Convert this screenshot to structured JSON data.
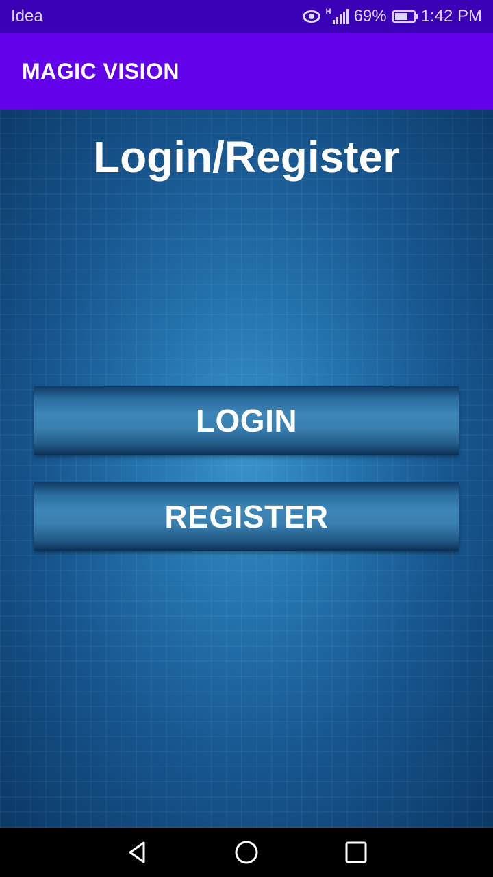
{
  "status_bar": {
    "carrier": "Idea",
    "network_type": "H",
    "battery_percent": "69%",
    "battery_level": 0.69,
    "time": "1:42 PM",
    "icons": [
      "eye-icon",
      "signal-icon",
      "battery-icon"
    ]
  },
  "app_bar": {
    "title": "MAGIC VISION"
  },
  "main": {
    "title": "Login/Register",
    "login_label": "LOGIN",
    "register_label": "REGISTER"
  },
  "nav_bar": {
    "icons": [
      "back-icon",
      "home-icon",
      "recents-icon"
    ]
  },
  "colors": {
    "status_bar": "#3a00b6",
    "app_bar": "#6200ea",
    "background": "#1e6aa6",
    "button_text": "#ffffff"
  }
}
